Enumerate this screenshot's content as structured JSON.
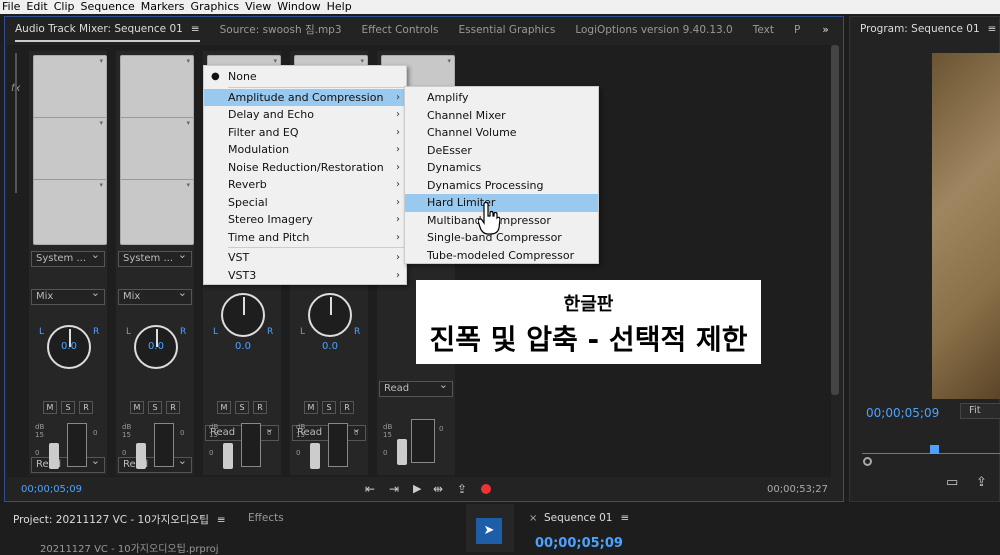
{
  "menubar": [
    "File",
    "Edit",
    "Clip",
    "Sequence",
    "Markers",
    "Graphics",
    "View",
    "Window",
    "Help"
  ],
  "tabs": {
    "mixer": "Audio Track Mixer: Sequence 01",
    "source": "Source: swoosh 짐.mp3",
    "effect_controls": "Effect Controls",
    "essential_graphics": "Essential Graphics",
    "logi": "LogiOptions version 9.40.13.0",
    "text": "Text",
    "p": "P",
    "more": "»"
  },
  "side": {
    "fx": "fx"
  },
  "strips": [
    {
      "route": "System ...",
      "mode": "Mix",
      "pan": "0.0",
      "read": "Read"
    },
    {
      "route": "System ...",
      "mode": "Mix",
      "pan": "0.0",
      "read": "Read"
    },
    {
      "route": "",
      "mode": "",
      "pan": "0.0",
      "read": "Read"
    },
    {
      "route": "",
      "mode": "",
      "pan": "0.0",
      "read": "Read"
    },
    {
      "route": "",
      "mode": "",
      "pan": "",
      "read": "Read"
    }
  ],
  "strip_labels": {
    "L": "L",
    "R": "R",
    "M": "M",
    "S": "S",
    "Rb": "R",
    "db": "dB",
    "n15": "15",
    "n0": "0",
    "z": "0"
  },
  "context_menu": {
    "none": "None",
    "items": [
      "Amplitude and Compression",
      "Delay and Echo",
      "Filter and EQ",
      "Modulation",
      "Noise Reduction/Restoration",
      "Reverb",
      "Special",
      "Stereo Imagery",
      "Time and Pitch"
    ],
    "plugins": [
      "VST",
      "VST3"
    ]
  },
  "submenu": [
    "Amplify",
    "Channel Mixer",
    "Channel Volume",
    "DeEsser",
    "Dynamics",
    "Dynamics Processing",
    "Hard Limiter",
    "Multiband Compressor",
    "Single-band Compressor",
    "Tube-modeled Compressor"
  ],
  "caption": {
    "line1": "한글판",
    "line2": "진폭 및 압축 - 선택적 제한"
  },
  "transport": {
    "left_tc": "00;00;05;09",
    "right_tc": "00;00;53;27"
  },
  "program": {
    "title": "Program: Sequence 01",
    "tc": "00;00;05;09",
    "fit": "Fit"
  },
  "bottom": {
    "project": "Project: 20211127 VC - 10가지오디오팁",
    "effects": "Effects",
    "seq_tab": "Sequence 01",
    "project_file": "20211127 VC - 10가지오디오팁.prproj",
    "seq_tc": "00;00;05;09",
    "close": "×"
  },
  "colors": {
    "accent": "#4ea2ff",
    "highlight": "#99c9ef",
    "record": "#e33"
  }
}
